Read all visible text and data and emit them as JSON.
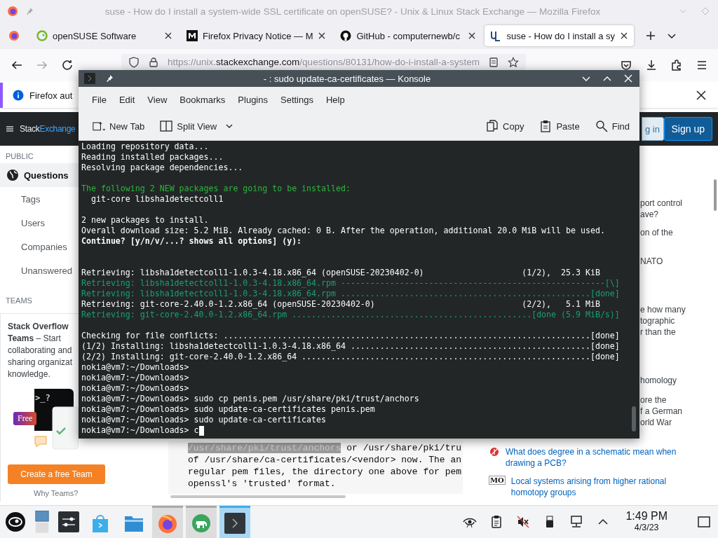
{
  "firefox": {
    "window_title": "suse - How do I install a system-wide SSL certificate on openSUSE? - Unix & Linux Stack Exchange — Mozilla Firefox",
    "tabs": [
      {
        "label": "openSUSE Software",
        "kind": "opensuse",
        "selected": false
      },
      {
        "label": "Firefox Privacy Notice — M",
        "kind": "mdn",
        "selected": false
      },
      {
        "label": "GitHub - computernewb/c",
        "kind": "github",
        "selected": false
      },
      {
        "label": "suse - How do I install a sy",
        "kind": "unix",
        "selected": true
      }
    ],
    "url": {
      "scheme": "https://unix.",
      "host": "stackexchange.com",
      "path": "/questions/80131/how-do-i-install-a-system"
    },
    "notification": "Firefox aut"
  },
  "site": {
    "logo_stack": "Stack",
    "logo_exchange": "Exchange",
    "login": "g in",
    "signup": "Sign up",
    "nav_heading": "PUBLIC",
    "nav": [
      {
        "label": "Questions",
        "selected": true
      },
      {
        "label": "Tags",
        "selected": false
      },
      {
        "label": "Users",
        "selected": false
      },
      {
        "label": "Companies",
        "selected": false
      },
      {
        "label": "Unanswered",
        "selected": false
      }
    ],
    "teams_heading": "TEAMS",
    "teams_card": {
      "lines": [
        "**Stack Overflow**",
        "**Teams** – Start",
        "collaborating and",
        "sharing organizat",
        "knowledge."
      ],
      "prompt": ">_?",
      "badge": "Free",
      "button": "Create a free Team",
      "link": "Why Teams?"
    },
    "code": [
      {
        "highlight": "/usr/share/pki/trust/anchors",
        "text": " or /usr/share/pki/tru"
      },
      {
        "text": "of /usr/share/ca-certificates/<vendor> now. The an"
      },
      {
        "text": "regular pem files, the directory one above for pem"
      },
      {
        "text": "openssl's 'trusted' format."
      }
    ],
    "fragments": [
      "port control\nave?",
      "on of the",
      "NATO",
      "e how many\ntographic\nr than the",
      "homology",
      "ore the\nf a German\norld War"
    ],
    "hot_questions": [
      {
        "kind": "electronics",
        "text": "What does degree in a schematic mean when drawing a PCB?"
      },
      {
        "kind": "mathoverflow",
        "icon_text": "MO",
        "text": "Local systems arising from higher rational homotopy groups"
      }
    ]
  },
  "konsole": {
    "title": "- : sudo update-ca-certificates — Konsole",
    "menu": [
      "File",
      "Edit",
      "View",
      "Bookmarks",
      "Plugins",
      "Settings",
      "Help"
    ],
    "toolbar_left": [
      {
        "label": "New Tab",
        "kind": "new-tab"
      },
      {
        "label": "Split View",
        "kind": "split-view"
      }
    ],
    "toolbar_right": [
      {
        "label": "Copy",
        "kind": "copy"
      },
      {
        "label": "Paste",
        "kind": "paste"
      },
      {
        "label": "Find",
        "kind": "find"
      }
    ],
    "lines": [
      {
        "kind": "plain",
        "text": "Loading repository data..."
      },
      {
        "kind": "plain",
        "text": "Reading installed packages..."
      },
      {
        "kind": "plain",
        "text": "Resolving package dependencies..."
      },
      {
        "kind": "blank"
      },
      {
        "kind": "green",
        "text": "The following 2 NEW packages are going to be installed:"
      },
      {
        "kind": "plain",
        "text": "  git-core libsha1detectcoll1"
      },
      {
        "kind": "blank"
      },
      {
        "kind": "plain",
        "text": "2 new packages to install."
      },
      {
        "kind": "plain",
        "text": "Overall download size: 5.2 MiB. Already cached: 0 B. After the operation, additional 20.0 MiB will be used."
      },
      {
        "kind": "bold",
        "text": "Continue? [y/n/v/...? shows all options] (y):"
      },
      {
        "kind": "blank"
      },
      {
        "kind": "blank"
      },
      {
        "kind": "plain",
        "text": "Retrieving: libsha1detectcoll1-1.0.3-4.18.x86_64 (openSUSE-20230402-0)                    (1/2),  25.3 KiB"
      },
      {
        "kind": "teal",
        "text": "Retrieving: libsha1detectcoll1-1.0.3-4.18.x86_64.rpm ------------------------------------------------------[\\]"
      },
      {
        "kind": "teal",
        "text": "Retrieving: libsha1detectcoll1-1.0.3-4.18.x86_64.rpm ...................................................[done]"
      },
      {
        "kind": "plain",
        "text": "Retrieving: git-core-2.40.0-1.2.x86_64 (openSUSE-20230402-0)                              (2/2),   5.1 MiB"
      },
      {
        "kind": "teal",
        "text": "Retrieving: git-core-2.40.0-1.2.x86_64.rpm .................................................[done (5.9 MiB/s)]"
      },
      {
        "kind": "blank"
      },
      {
        "kind": "plain",
        "text": "Checking for file conflicts: ...........................................................................[done]"
      },
      {
        "kind": "plain",
        "text": "(1/2) Installing: libsha1detectcoll1-1.0.3-4.18.x86_64 .................................................[done]"
      },
      {
        "kind": "plain",
        "text": "(2/2) Installing: git-core-2.40.0-1.2.x86_64 ...........................................................[done]"
      },
      {
        "kind": "plain",
        "text": "nokia@vm7:~/Downloads>"
      },
      {
        "kind": "plain",
        "text": "nokia@vm7:~/Downloads>"
      },
      {
        "kind": "plain",
        "text": "nokia@vm7:~/Downloads>"
      },
      {
        "kind": "plain",
        "text": "nokia@vm7:~/Downloads> sudo cp penis.pem /usr/share/pki/trust/anchors"
      },
      {
        "kind": "plain",
        "text": "nokia@vm7:~/Downloads> sudo update-ca-certificates penis.pem"
      },
      {
        "kind": "plain",
        "text": "nokia@vm7:~/Downloads> sudo update-ca-certificates"
      },
      {
        "kind": "cursor",
        "text": "nokia@vm7:~/Downloads> c"
      }
    ]
  },
  "taskbar": {
    "tasks": [
      {
        "kind": "discover",
        "running": false,
        "selected": false
      },
      {
        "kind": "files",
        "running": false,
        "selected": false
      },
      {
        "kind": "firefox",
        "running": true,
        "selected": false
      },
      {
        "kind": "elephant",
        "running": true,
        "selected": false
      },
      {
        "kind": "terminal",
        "running": true,
        "selected": true
      }
    ],
    "time": "1:49 PM",
    "date": "4/3/23"
  }
}
